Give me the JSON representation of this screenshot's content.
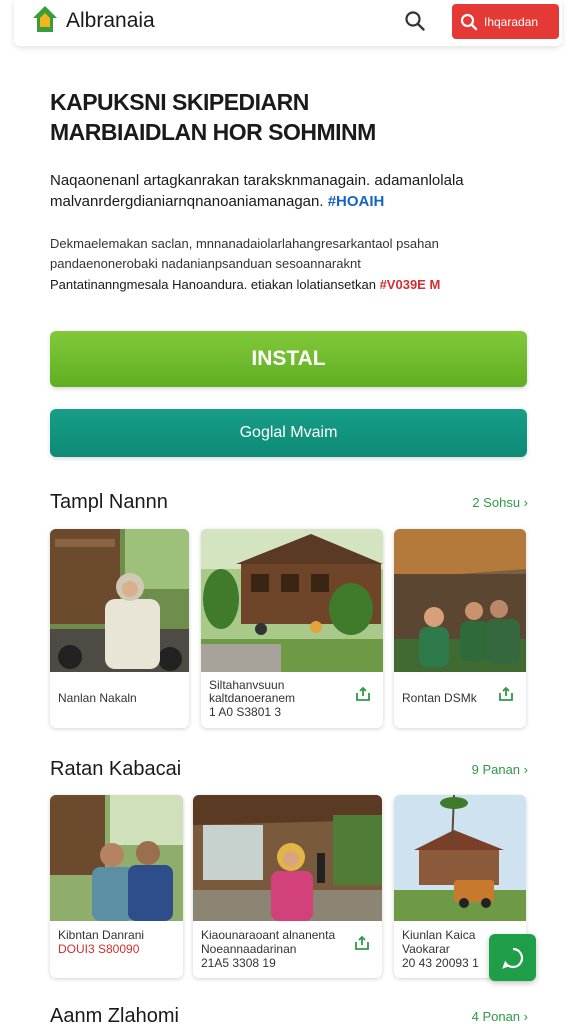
{
  "header": {
    "brand": "Albranaia",
    "cta_label": "Ihqaradan"
  },
  "hero": {
    "title_line1": "KAPUKSNI SKIPEDIARN",
    "title_line2": "MARBIAIDLAN HOR SOHMINM",
    "p1_text": "Naqaonenanl artagkanrakan taraksknmanagain. adamanlolala malvanrdergdianiarnqnanoaniamanagan.",
    "p1_highlight": "#HOAIH",
    "p2_line1": "Dekmaelemakan saclan, mnnanadaiolarlahangresarkantaol psahan",
    "p2_line2": "pandaenonerobaki nadanianpsanduan sesoannaraknt",
    "p3_text": "Pantatinanngmesala Hanoandura. etiakan lolatiansetkan",
    "p3_highlight": "#V039E M"
  },
  "buttons": {
    "install": "INSTAL",
    "secondary": "Goglal Mvaim"
  },
  "section1": {
    "title": "Tampl Nannn",
    "link": "2 Sohsu",
    "cards": [
      {
        "line1": "Nanlan Nakaln",
        "line2": ""
      },
      {
        "line1": "Siltahanvsuun",
        "line2": "kaltdanoeranem",
        "line3": "1 A0 S3801 3"
      },
      {
        "line1": "Rontan DSMk",
        "line2": ""
      }
    ]
  },
  "section2": {
    "title": "Ratan Kabacai",
    "link": "9 Panan",
    "cards": [
      {
        "line1": "Kibntan Danrani",
        "line2": "DOUI3 S80090"
      },
      {
        "line1": "Kiaounaraoant alnanenta",
        "line2": "Noeannaadarinan",
        "line3": "21A5 3308 19"
      },
      {
        "line1": "Kiunlan Kaica",
        "line2": "Vaokarar",
        "line3": "20 43 20093 1"
      }
    ]
  },
  "section3": {
    "title": "Aanm Zlahomi",
    "link": "4 Ponan"
  },
  "colors": {
    "install_green": "#6fbe2e",
    "secondary_teal": "#139483",
    "cta_red": "#e53935",
    "link_green": "#2e9a47",
    "highlight_blue": "#1565c0",
    "highlight_red": "#d32f2f"
  },
  "icons": {
    "logo": "house-logo-icon",
    "search": "search-icon",
    "share": "share-icon",
    "fab": "chat-icon"
  }
}
